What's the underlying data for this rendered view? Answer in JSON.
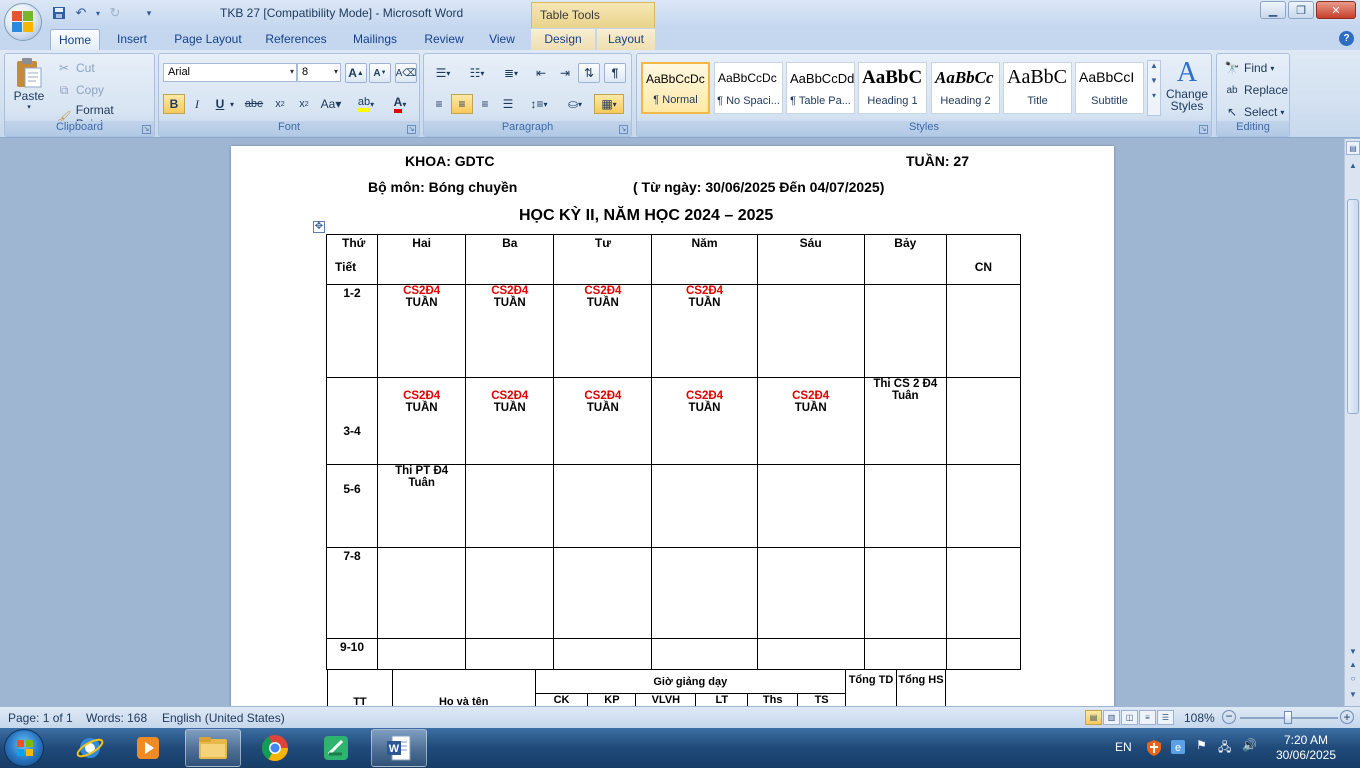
{
  "window": {
    "title": "TKB 27 [Compatibility Mode] - Microsoft Word",
    "context_tab_title": "Table Tools"
  },
  "tabs": [
    "Home",
    "Insert",
    "Page Layout",
    "References",
    "Mailings",
    "Review",
    "View",
    "Design",
    "Layout"
  ],
  "ribbon": {
    "clipboard": {
      "paste": "Paste",
      "cut": "Cut",
      "copy": "Copy",
      "format_painter": "Format Painter",
      "label": "Clipboard"
    },
    "font": {
      "name": "Arial",
      "size": "8",
      "label": "Font"
    },
    "paragraph": {
      "label": "Paragraph"
    },
    "styles": {
      "label": "Styles",
      "items": [
        {
          "sample": "AaBbCcDc",
          "name": "¶ Normal"
        },
        {
          "sample": "AaBbCcDc",
          "name": "¶ No Spaci..."
        },
        {
          "sample": "AaBbCcDd",
          "name": "¶ Table Pa..."
        },
        {
          "sample": "AaBbC",
          "name": "Heading 1"
        },
        {
          "sample": "AaBbCc",
          "name": "Heading 2"
        },
        {
          "sample": "AaBbC",
          "name": "Title"
        },
        {
          "sample": "AaBbCcI",
          "name": "Subtitle"
        }
      ],
      "change_styles": "Change Styles"
    },
    "editing": {
      "find": "Find",
      "replace": "Replace",
      "select": "Select",
      "label": "Editing"
    }
  },
  "document": {
    "khoa": "KHOA: GDTC",
    "tuan": "TUẦN: 27",
    "bo_mon": "Bộ môn: Bóng chuyền",
    "date_range": "( Từ ngày: 30/06/2025  Đến 04/07/2025)",
    "semester": "HỌC KỲ II, NĂM HỌC 2024 – 2025",
    "schedule": {
      "header_thu": "Thứ",
      "header_tiet": "Tiết",
      "days": [
        "Hai",
        "Ba",
        "Tư",
        "Năm",
        "Sáu",
        "Bảy",
        "CN"
      ],
      "rows": [
        {
          "period": "1-2",
          "cells": [
            {
              "red": "CS2Đ4",
              "black": "TUẦN"
            },
            {
              "red": "CS2Đ4",
              "black": "TUẦN"
            },
            {
              "red": "CS2Đ4",
              "black": "TUẦN"
            },
            {
              "red": "CS2Đ4",
              "black": "TUẦN"
            },
            {
              "red": "",
              "black": ""
            },
            {
              "red": "",
              "black": ""
            },
            {
              "red": "",
              "black": ""
            }
          ]
        },
        {
          "period": "3-4",
          "cells": [
            {
              "red": "CS2Đ4",
              "black": "TUẦN"
            },
            {
              "red": "CS2Đ4",
              "black": "TUẦN"
            },
            {
              "red": "CS2Đ4",
              "black": "TUẦN"
            },
            {
              "red": "CS2Đ4",
              "black": "TUẦN"
            },
            {
              "red": "CS2Đ4",
              "black": "TUẦN"
            },
            {
              "red": "",
              "black": "Thi CS 2 Đ4",
              "black2": "Tuân"
            },
            {
              "red": "",
              "black": ""
            }
          ]
        },
        {
          "period": "5-6",
          "cells": [
            {
              "red": "",
              "black": "Thi PT Đ4",
              "black2": "Tuân"
            },
            {
              "red": "",
              "black": ""
            },
            {
              "red": "",
              "black": ""
            },
            {
              "red": "",
              "black": ""
            },
            {
              "red": "",
              "black": ""
            },
            {
              "red": "",
              "black": ""
            },
            {
              "red": "",
              "black": ""
            }
          ]
        },
        {
          "period": "7-8",
          "cells": [
            {
              "red": "",
              "black": ""
            },
            {
              "red": "",
              "black": ""
            },
            {
              "red": "",
              "black": ""
            },
            {
              "red": "",
              "black": ""
            },
            {
              "red": "",
              "black": ""
            },
            {
              "red": "",
              "black": ""
            },
            {
              "red": "",
              "black": ""
            }
          ]
        },
        {
          "period": "9-10",
          "cells": [
            {
              "red": "",
              "black": ""
            },
            {
              "red": "",
              "black": ""
            },
            {
              "red": "",
              "black": ""
            },
            {
              "red": "",
              "black": ""
            },
            {
              "red": "",
              "black": ""
            },
            {
              "red": "",
              "black": ""
            },
            {
              "red": "",
              "black": ""
            }
          ]
        }
      ]
    },
    "summary": {
      "tt": "TT",
      "ho_ten": "Họ và tên",
      "gio_giang_day": "Giờ giảng dạy",
      "sub": [
        "CK",
        "KP",
        "VLVH",
        "LT",
        "Ths",
        "TS"
      ],
      "tong_td": "Tổng TD",
      "tong_hs": "Tổng HS"
    }
  },
  "statusbar": {
    "page": "Page: 1 of 1",
    "words": "Words: 168",
    "language": "English (United States)",
    "zoom": "108%"
  },
  "taskbar": {
    "lang": "EN",
    "time": "7:20 AM",
    "date": "30/06/2025"
  },
  "colors": {
    "accent_red": "#e00000",
    "ribbon_bg": "#dfe9f5",
    "taskbar": "#1f4a79"
  }
}
